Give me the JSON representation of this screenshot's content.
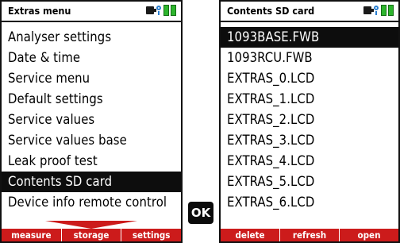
{
  "left_screen": {
    "title": "Extras menu",
    "menu_items": [
      {
        "label": "Analyser settings",
        "selected": false
      },
      {
        "label": "Date & time",
        "selected": false
      },
      {
        "label": "Service menu",
        "selected": false
      },
      {
        "label": "Default settings",
        "selected": false
      },
      {
        "label": "Service values",
        "selected": false
      },
      {
        "label": "Service values base",
        "selected": false
      },
      {
        "label": "Leak proof test",
        "selected": false
      },
      {
        "label": "Contents SD card",
        "selected": true
      },
      {
        "label": "Device info remote control",
        "selected": false
      }
    ],
    "softkeys": [
      "measure",
      "storage",
      "settings"
    ]
  },
  "ok_key": {
    "label": "OK"
  },
  "right_screen": {
    "title": "Contents SD card",
    "files": [
      {
        "label": "1093BASE.FWB",
        "selected": true
      },
      {
        "label": "1093RCU.FWB",
        "selected": false
      },
      {
        "label": "EXTRAS_0.LCD",
        "selected": false
      },
      {
        "label": "EXTRAS_1.LCD",
        "selected": false
      },
      {
        "label": "EXTRAS_2.LCD",
        "selected": false
      },
      {
        "label": "EXTRAS_3.LCD",
        "selected": false
      },
      {
        "label": "EXTRAS_4.LCD",
        "selected": false
      },
      {
        "label": "EXTRAS_5.LCD",
        "selected": false
      },
      {
        "label": "EXTRAS_6.LCD",
        "selected": false
      }
    ],
    "softkeys": [
      "delete",
      "refresh",
      "open"
    ]
  },
  "colors": {
    "softkey_bar": "#cc1b1b",
    "selection": "#0d0d0d",
    "battery": "#2db52d",
    "wireless": "#2a7fd0"
  },
  "icons": [
    "power-plug-icon",
    "wireless-icon",
    "battery-icon",
    "battery-icon"
  ]
}
